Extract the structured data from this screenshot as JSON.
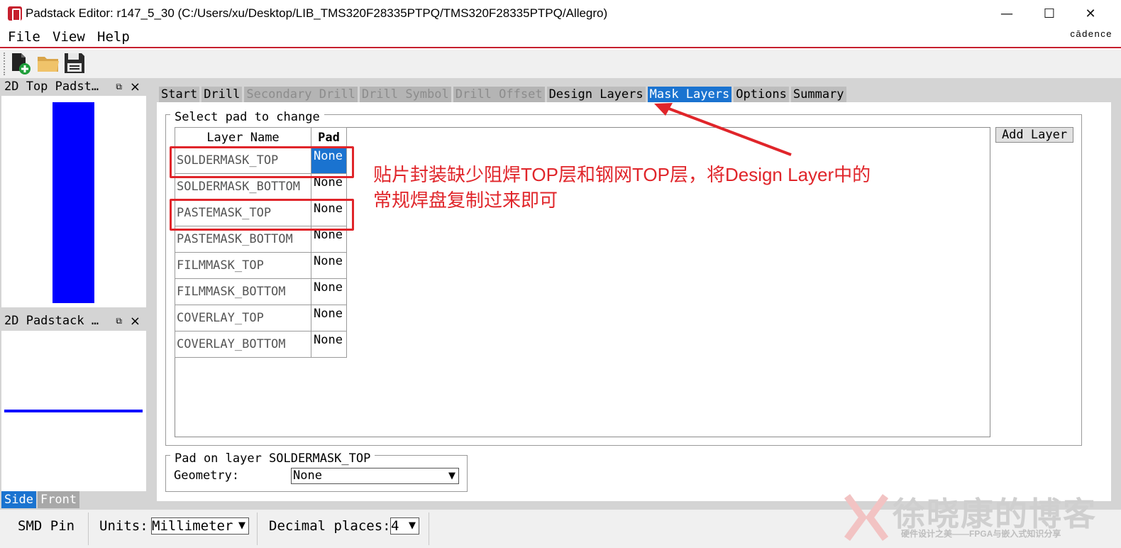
{
  "window": {
    "title": "Padstack Editor: r147_5_30  (C:/Users/xu/Desktop/LIB_TMS320F28335PTPQ/TMS320F28335PTPQ/Allegro)",
    "minimize": "—",
    "maximize": "☐",
    "close": "✕",
    "brand": "cādence"
  },
  "menu": [
    "File",
    "View",
    "Help"
  ],
  "toolbar": {
    "new_icon": "new-file-icon",
    "open_icon": "open-folder-icon",
    "save_icon": "save-disk-icon"
  },
  "panels": {
    "top_view_title": "2D Top Padst…",
    "side_view_title": "2D Padstack …",
    "pin_glyph": "⧉",
    "close_glyph": "×",
    "side_tabs": [
      "Side",
      "Front"
    ],
    "pad_color": "#0000ff"
  },
  "tabs": [
    {
      "label": "Start",
      "state": "normal"
    },
    {
      "label": "Drill",
      "state": "normal"
    },
    {
      "label": "Secondary Drill",
      "state": "disabled"
    },
    {
      "label": "Drill Symbol",
      "state": "disabled"
    },
    {
      "label": "Drill Offset",
      "state": "disabled"
    },
    {
      "label": "Design Layers",
      "state": "normal"
    },
    {
      "label": "Mask Layers",
      "state": "active"
    },
    {
      "label": "Options",
      "state": "normal"
    },
    {
      "label": "Summary",
      "state": "normal"
    }
  ],
  "select_group": {
    "label": "Select pad to change",
    "columns": [
      "Layer Name",
      "Pad"
    ],
    "rows": [
      {
        "layer": "SOLDERMASK_TOP",
        "pad": "None",
        "selected": true
      },
      {
        "layer": "SOLDERMASK_BOTTOM",
        "pad": "None"
      },
      {
        "layer": "PASTEMASK_TOP",
        "pad": "None"
      },
      {
        "layer": "PASTEMASK_BOTTOM",
        "pad": "None"
      },
      {
        "layer": "FILMMASK_TOP",
        "pad": "None"
      },
      {
        "layer": "FILMMASK_BOTTOM",
        "pad": "None"
      },
      {
        "layer": "COVERLAY_TOP",
        "pad": "None"
      },
      {
        "layer": "COVERLAY_BOTTOM",
        "pad": "None"
      }
    ],
    "add_layer": "Add Layer"
  },
  "annotation": {
    "line1": "贴片封装缺少阻焊TOP层和钢网TOP层，将Design Layer中的",
    "line2": "常规焊盘复制过来即可",
    "color": "#e0252a"
  },
  "pad_group": {
    "label": "Pad on layer SOLDERMASK_TOP",
    "geometry_label": "Geometry:",
    "geometry_value": "None"
  },
  "statusbar": {
    "pin_type": "SMD Pin",
    "units_label": "Units:",
    "units_value": "Millimeter",
    "decimal_label": "Decimal places:",
    "decimal_value": "4"
  },
  "watermark": {
    "title": "徐晓康的博客",
    "subtitle": "硬件设计之美——FPGA与嵌入式知识分享"
  }
}
